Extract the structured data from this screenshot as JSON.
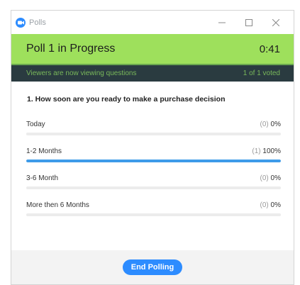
{
  "window": {
    "title": "Polls"
  },
  "banner": {
    "title": "Poll 1 in Progress",
    "timer": "0:41",
    "status": "Viewers are now viewing questions",
    "votes": "1 of 1 voted"
  },
  "question": {
    "text": "1. How soon are you ready to make a purchase decision",
    "answers": [
      {
        "label": "Today",
        "count": "(0)",
        "percent": "0%",
        "fraction": 0
      },
      {
        "label": "1-2 Months",
        "count": "(1)",
        "percent": "100%",
        "fraction": 1
      },
      {
        "label": "3-6 Month",
        "count": "(0)",
        "percent": "0%",
        "fraction": 0
      },
      {
        "label": "More then 6 Months",
        "count": "(0)",
        "percent": "0%",
        "fraction": 0
      }
    ]
  },
  "footer": {
    "end_button": "End Polling"
  },
  "colors": {
    "banner": "#9ee05c",
    "status_bg": "#2a3b40",
    "accent": "#2d8cff",
    "bar_fill": "#3d9be9"
  },
  "icons": {
    "app": "zoom-camera-icon",
    "minimize": "minimize-icon",
    "maximize": "maximize-icon",
    "close": "close-icon"
  }
}
